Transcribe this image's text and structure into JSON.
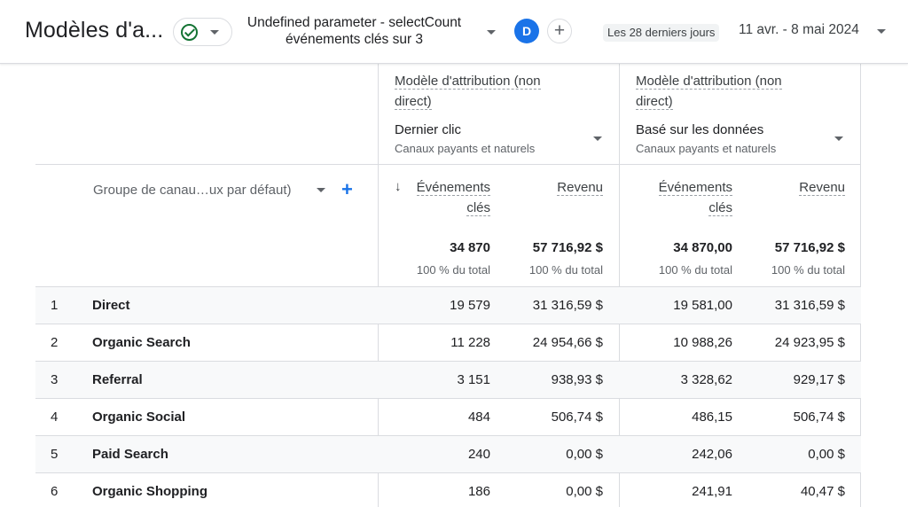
{
  "header": {
    "title": "Modèles d'a...",
    "comparison": "Undefined parameter - selectCount événements clés sur 3",
    "avatar_letter": "D",
    "add_symbol": "+",
    "date_chip": "Les 28 derniers jours",
    "date_range": "11 avr. - 8 mai 2024"
  },
  "models": [
    {
      "title": "Modèle d'attribution (non direct)",
      "name": "Dernier clic",
      "sub": "Canaux payants et naturels"
    },
    {
      "title": "Modèle d'attribution (non direct)",
      "name": "Basé sur les données",
      "sub": "Canaux payants et naturels"
    }
  ],
  "dimension": {
    "label": "Groupe de canau…ux par défaut)",
    "add_symbol": "+"
  },
  "metrics": {
    "events_line1": "Événements",
    "events_line2": "clés",
    "revenue": "Revenu",
    "sort_arrow": "↓"
  },
  "totals": [
    {
      "value": "34 870",
      "pct": "100 % du total"
    },
    {
      "value": "57 716,92 $",
      "pct": "100 % du total"
    },
    {
      "value": "34 870,00",
      "pct": "100 % du total"
    },
    {
      "value": "57 716,92 $",
      "pct": "100 % du total"
    }
  ],
  "rows": [
    {
      "rank": "1",
      "channel": "Direct",
      "ev1": "19 579",
      "rev1": "31 316,59 $",
      "ev2": "19 581,00",
      "rev2": "31 316,59 $"
    },
    {
      "rank": "2",
      "channel": "Organic Search",
      "ev1": "11 228",
      "rev1": "24 954,66 $",
      "ev2": "10 988,26",
      "rev2": "24 923,95 $"
    },
    {
      "rank": "3",
      "channel": "Referral",
      "ev1": "3 151",
      "rev1": "938,93 $",
      "ev2": "3 328,62",
      "rev2": "929,17 $"
    },
    {
      "rank": "4",
      "channel": "Organic Social",
      "ev1": "484",
      "rev1": "506,74 $",
      "ev2": "486,15",
      "rev2": "506,74 $"
    },
    {
      "rank": "5",
      "channel": "Paid Search",
      "ev1": "240",
      "rev1": "0,00 $",
      "ev2": "242,06",
      "rev2": "0,00 $"
    },
    {
      "rank": "6",
      "channel": "Organic Shopping",
      "ev1": "186",
      "rev1": "0,00 $",
      "ev2": "241,91",
      "rev2": "40,47 $"
    }
  ]
}
